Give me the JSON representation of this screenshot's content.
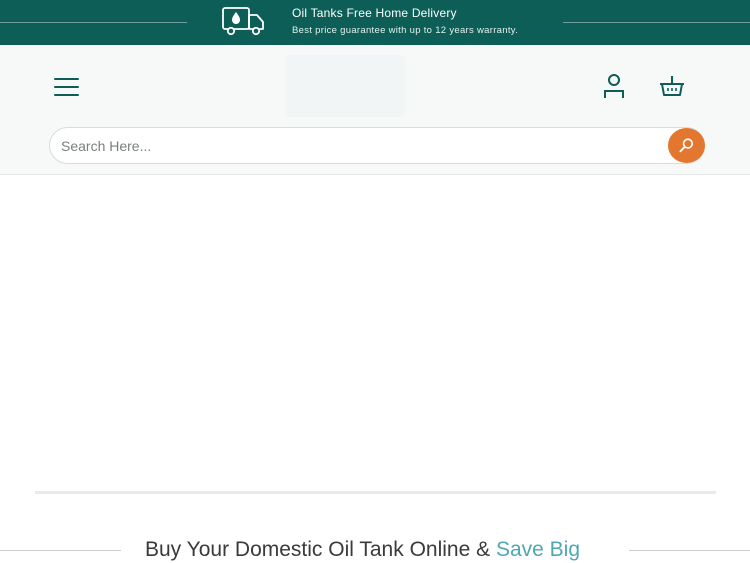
{
  "promo_bar": {
    "icon": "delivery-truck-oil-drop-icon",
    "title": "Oil Tanks Free Home Delivery",
    "subtitle": "Best price guarantee with up to 12 years warranty.",
    "background_color": "#0c5e57"
  },
  "header": {
    "menu_icon": "hamburger-menu-icon",
    "account_icon": "user-account-icon",
    "basket_icon": "shopping-basket-icon"
  },
  "search": {
    "placeholder": "Search Here...",
    "value": "",
    "button_icon": "search-icon",
    "button_color": "#e4772f"
  },
  "section": {
    "heading_main": "Buy Your Domestic Oil Tank Online & ",
    "heading_accent": "Save Big",
    "accent_color": "#4fa7b3"
  }
}
